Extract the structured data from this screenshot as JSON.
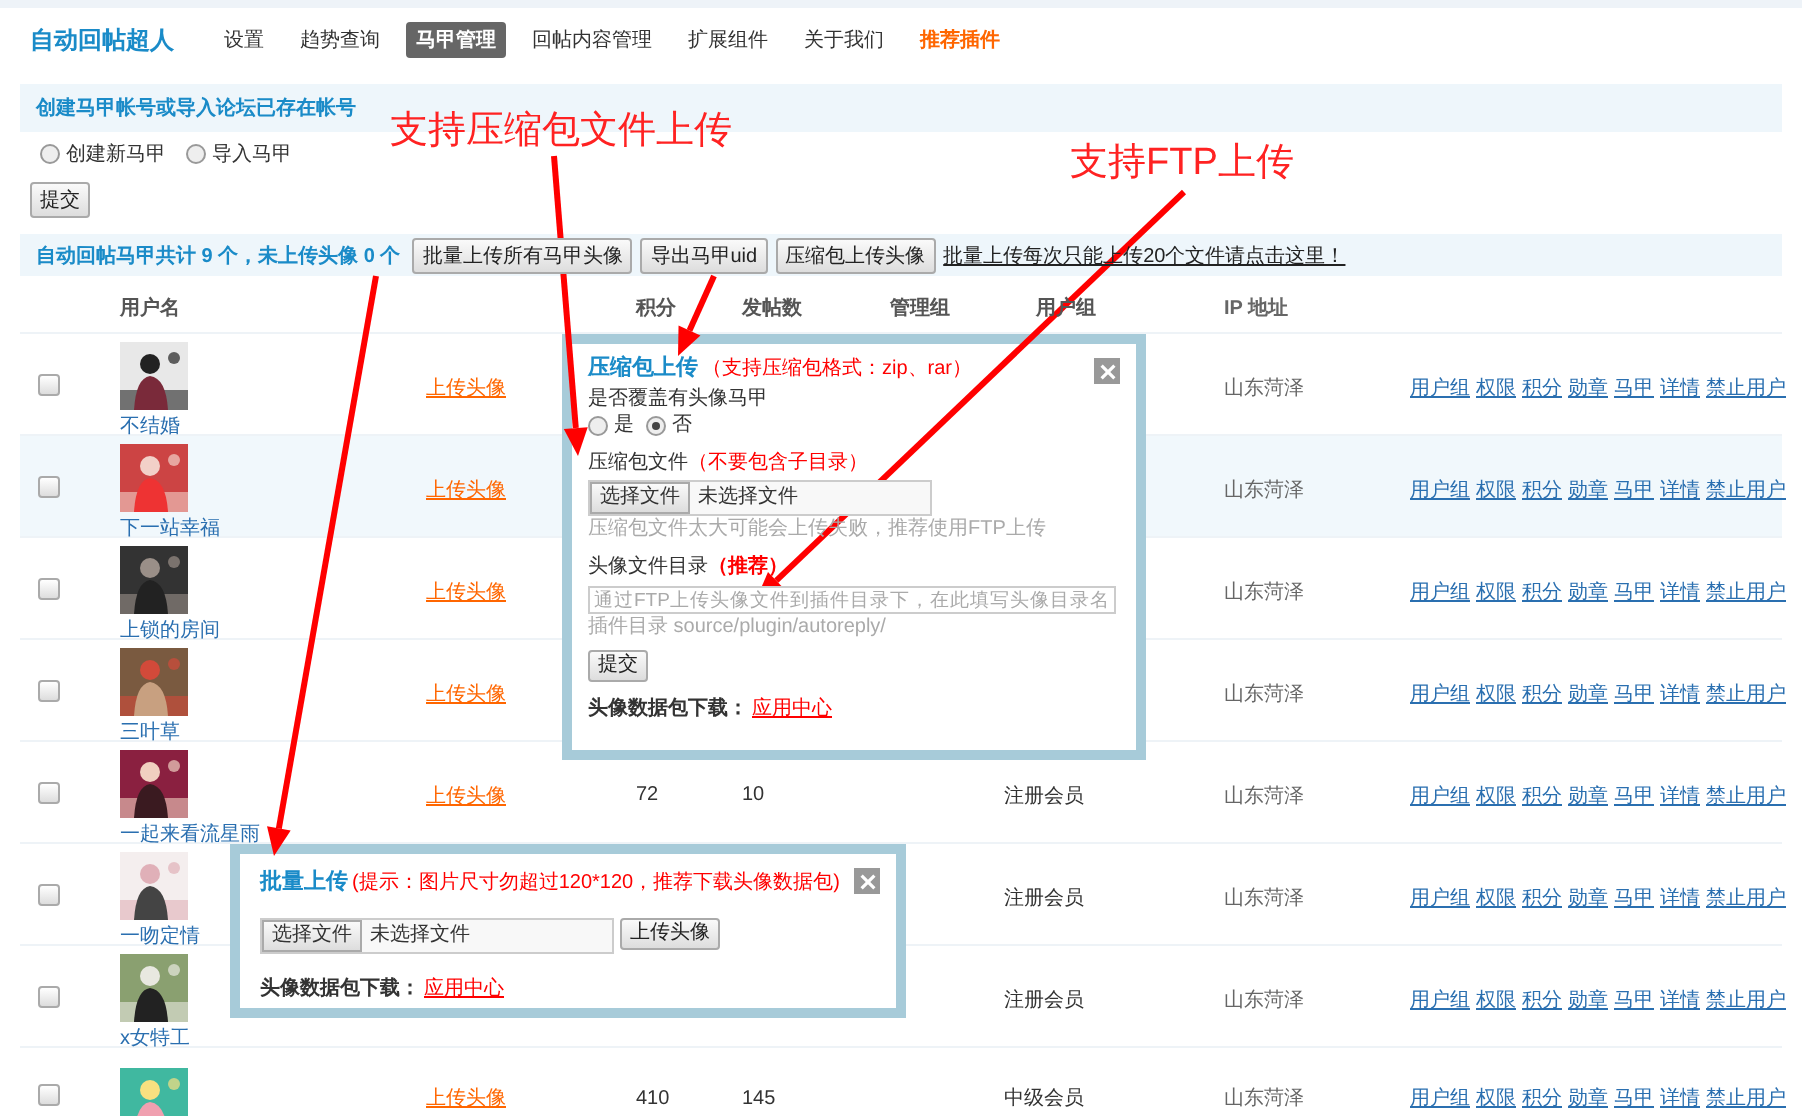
{
  "app_title": "自动回帖超人",
  "nav": [
    {
      "label": "设置",
      "selected": false,
      "kind": "normal"
    },
    {
      "label": "趋势查询",
      "selected": false,
      "kind": "normal"
    },
    {
      "label": "马甲管理",
      "selected": true,
      "kind": "normal"
    },
    {
      "label": "回帖内容管理",
      "selected": false,
      "kind": "normal"
    },
    {
      "label": "扩展组件",
      "selected": false,
      "kind": "normal"
    },
    {
      "label": "关于我们",
      "selected": false,
      "kind": "normal"
    },
    {
      "label": "推荐插件",
      "selected": false,
      "kind": "promo"
    }
  ],
  "create_section": {
    "heading": "创建马甲帐号或导入论坛已存在帐号",
    "options": [
      {
        "label": "创建新马甲",
        "selected": false
      },
      {
        "label": "导入马甲",
        "selected": false
      }
    ],
    "submit": "提交"
  },
  "summary": {
    "text": "自动回帖马甲共计 9 个，未上传头像 0 个",
    "buttons": [
      "批量上传所有马甲头像",
      "导出马甲uid",
      "压缩包上传头像"
    ],
    "link": "批量上传每次只能上传20个文件请点击这里！"
  },
  "table": {
    "columns": [
      "用户名",
      "",
      "积分",
      "发帖数",
      "管理组",
      "用户组",
      "IP 地址"
    ],
    "rows": [
      {
        "checked": false,
        "highlighted": false,
        "name": "不结婚",
        "upload_link": "上传头像",
        "ip": "山东菏泽",
        "actions": [
          "用户组",
          "权限",
          "积分",
          "勋章",
          "马甲",
          "详情",
          "禁止用户"
        ]
      },
      {
        "checked": false,
        "highlighted": true,
        "name": "下一站幸福",
        "upload_link": "上传头像",
        "ip": "山东菏泽",
        "actions": [
          "用户组",
          "权限",
          "积分",
          "勋章",
          "马甲",
          "详情",
          "禁止用户"
        ]
      },
      {
        "checked": false,
        "highlighted": false,
        "name": "上锁的房间",
        "upload_link": "上传头像",
        "ip": "山东菏泽",
        "actions": [
          "用户组",
          "权限",
          "积分",
          "勋章",
          "马甲",
          "详情",
          "禁止用户"
        ]
      },
      {
        "checked": false,
        "highlighted": false,
        "name": "三叶草",
        "upload_link": "上传头像",
        "ip": "山东菏泽",
        "actions": [
          "用户组",
          "权限",
          "积分",
          "勋章",
          "马甲",
          "详情",
          "禁止用户"
        ]
      },
      {
        "checked": false,
        "highlighted": false,
        "name": "一起来看流星雨",
        "upload_link": "上传头像",
        "points": "72",
        "posts": "10",
        "group": "注册会员",
        "ip": "山东菏泽",
        "actions": [
          "用户组",
          "权限",
          "积分",
          "勋章",
          "马甲",
          "详情",
          "禁止用户"
        ]
      },
      {
        "checked": false,
        "highlighted": false,
        "name": "一吻定情",
        "group": "注册会员",
        "ip": "山东菏泽",
        "actions": [
          "用户组",
          "权限",
          "积分",
          "勋章",
          "马甲",
          "详情",
          "禁止用户"
        ]
      },
      {
        "checked": false,
        "highlighted": false,
        "name": "x女特工",
        "group": "注册会员",
        "ip": "山东菏泽",
        "actions": [
          "用户组",
          "权限",
          "积分",
          "勋章",
          "马甲",
          "详情",
          "禁止用户"
        ]
      },
      {
        "checked": false,
        "highlighted": false,
        "upload_link": "上传头像",
        "points": "410",
        "posts": "145",
        "group": "中级会员",
        "ip": "山东菏泽",
        "actions": [
          "用户组",
          "权限",
          "积分",
          "勋章",
          "马甲",
          "详情",
          "禁止用户"
        ]
      }
    ]
  },
  "zip_dialog": {
    "title": "压缩包上传",
    "note": "（支持压缩包格式：zip、rar）",
    "overwrite_label": "是否覆盖有头像马甲",
    "overwrite_options": [
      {
        "label": "是",
        "selected": false
      },
      {
        "label": "否",
        "selected": true
      }
    ],
    "file_label": "压缩包文件",
    "file_note": "（不要包含子目录）",
    "choose_button": "选择文件",
    "file_status": "未选择文件",
    "file_hint": "压缩包文件太大可能会上传失败，推荐使用FTP上传",
    "dir_label": "头像文件目录",
    "dir_note": "（推荐）",
    "dir_placeholder": "通过FTP上传头像文件到插件目录下，在此填写头像目录名",
    "dir_hint": "插件目录 source/plugin/autoreply/",
    "submit": "提交",
    "download_label": "头像数据包下载：",
    "download_link": "应用中心"
  },
  "batch_dialog": {
    "title": "批量上传",
    "note": "(提示：图片尺寸勿超过120*120，推荐下载头像数据包)",
    "choose_button": "选择文件",
    "file_status": "未选择文件",
    "upload_button": "上传头像",
    "download_label": "头像数据包下载：",
    "download_link": "应用中心"
  },
  "annotations": [
    "支持压缩包文件上传",
    "支持FTP上传"
  ]
}
